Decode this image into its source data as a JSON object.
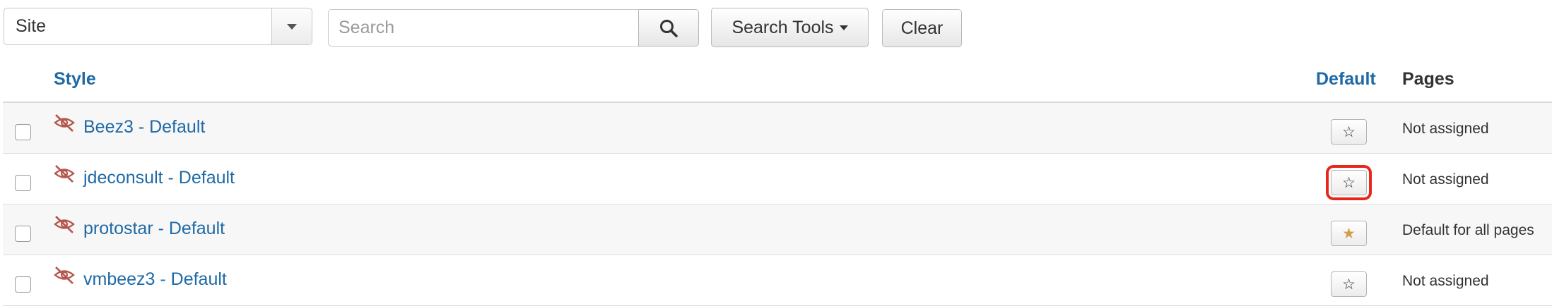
{
  "filter": {
    "client_select_value": "Site",
    "search_placeholder": "Search",
    "search_tools_label": "Search Tools",
    "clear_label": "Clear"
  },
  "table": {
    "headers": {
      "style": "Style",
      "default": "Default",
      "pages": "Pages"
    },
    "rows": [
      {
        "style": "Beez3 - Default",
        "is_default": false,
        "pages": "Not assigned"
      },
      {
        "style": "jdeconsult - Default",
        "is_default": false,
        "pages": "Not assigned",
        "highlighted": true
      },
      {
        "style": "protostar - Default",
        "is_default": true,
        "pages": "Default for all pages"
      },
      {
        "style": "vmbeez3 - Default",
        "is_default": false,
        "pages": "Not assigned"
      }
    ]
  },
  "colors": {
    "link": "#1f6aa6",
    "hidden_icon": "#b5574d",
    "default_star": "#d89a45",
    "highlight_outline": "#e8261c"
  },
  "icons": {
    "search": "search-icon",
    "caret": "caret-down-icon",
    "hidden": "eye-slash-icon",
    "star_empty": "star-outline-icon",
    "star_filled": "star-filled-icon"
  }
}
